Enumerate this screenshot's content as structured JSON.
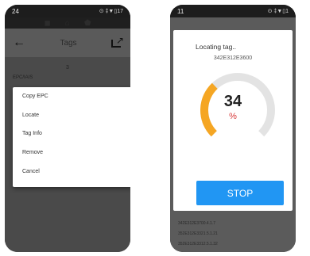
{
  "left_screen": {
    "status_time": "24",
    "status_right": "⊙ ‡▼▯17",
    "title": "Tags",
    "tag_count": "3",
    "epc_header": "EPC/IAIS",
    "menu": [
      "Copy EPC",
      "Locate",
      "Tag Info",
      "Remove",
      "Cancel"
    ]
  },
  "right_screen": {
    "status_time": "11",
    "status_right": "⊙ ‡▼▯1",
    "dialog": {
      "title": "Locating tag..",
      "epc": "342E312E3600",
      "gauge_value": "34",
      "gauge_unit": "%",
      "gauge_percent": 34,
      "stop_label": "STOP"
    },
    "tags": [
      "342E312E3700.4.1.7",
      "352E312E3321.5.1.21",
      "352E312E3312.5.1.32"
    ]
  },
  "colors": {
    "accent": "#2196f3",
    "gauge_fill": "#f5a623",
    "gauge_track": "#e3e3e3",
    "percent_sign": "#d83a3a"
  }
}
